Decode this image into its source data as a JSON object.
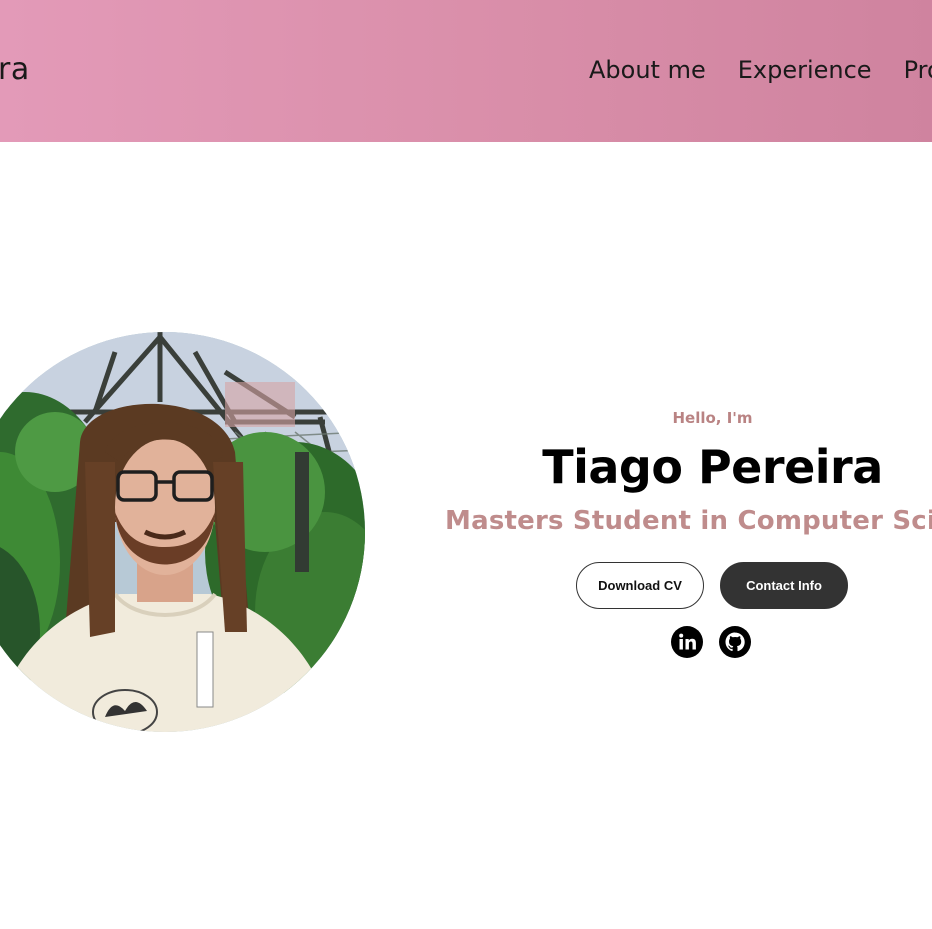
{
  "header": {
    "logo_text": "ra",
    "nav": [
      {
        "label": "About me"
      },
      {
        "label": "Experience"
      },
      {
        "label": "Pro"
      }
    ]
  },
  "hero": {
    "greeting": "Hello, I'm",
    "name": "Tiago Pereira",
    "subtitle": "Masters Student in Computer Scien",
    "buttons": {
      "download_cv": "Download CV",
      "contact_info": "Contact Info"
    },
    "socials": [
      {
        "icon": "linkedin-icon"
      },
      {
        "icon": "github-icon"
      }
    ]
  },
  "colors": {
    "header_gradient_start": "#e39ab8",
    "header_gradient_end": "#cf839f",
    "accent_text": "#bf8c8c",
    "button_dark": "#333333"
  }
}
